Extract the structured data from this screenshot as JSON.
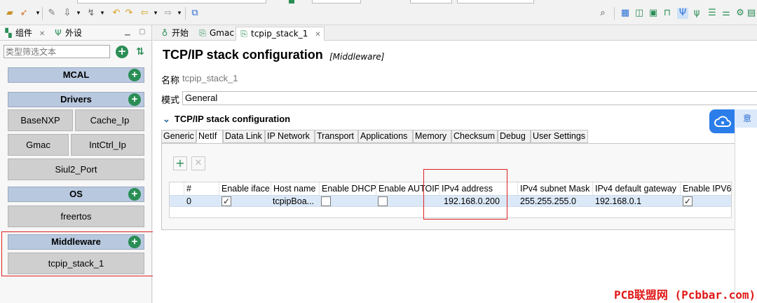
{
  "colors": {
    "accent_green": "#2a8e55",
    "highlight_red": "#e02020",
    "category_blue": "#b8c8df",
    "row_selected": "#dbe8f7",
    "watermark_red": "#e01818"
  },
  "toolbar": {
    "icons": [
      "folder-icon",
      "rocket-icon",
      "pencil-icon",
      "download-icon",
      "navigate-icon",
      "undo-icon",
      "back-icon",
      "forward-icon",
      "new-window-icon",
      "search-icon",
      "view-icons"
    ]
  },
  "left_panel": {
    "tabs": [
      {
        "label": "组件",
        "icon": "components-icon"
      },
      {
        "label": "外设",
        "icon": "peripherals-icon"
      }
    ],
    "filter_placeholder": "类型筛选文本",
    "categories": [
      {
        "label": "MCAL",
        "items": []
      },
      {
        "label": "Drivers",
        "items": [
          "BaseNXP",
          "Cache_Ip",
          "Gmac",
          "IntCtrl_Ip",
          "Siul2_Port"
        ]
      },
      {
        "label": "OS",
        "items": [
          "freertos"
        ]
      },
      {
        "label": "Middleware",
        "items": [
          "tcpip_stack_1"
        ]
      }
    ]
  },
  "editor": {
    "tabs": [
      {
        "label": "开始",
        "icon": "bulb-icon"
      },
      {
        "label": "Gmac",
        "icon": "config-icon"
      },
      {
        "label": "tcpip_stack_1",
        "icon": "config-icon",
        "active": true
      }
    ],
    "title": "TCP/IP stack configuration",
    "title_sub": "[Middleware]",
    "name_label": "名称",
    "name_value": "tcpip_stack_1",
    "mode_label": "模式",
    "mode_value": "General",
    "section_title": "TCP/IP stack configuration",
    "sub_tabs": [
      "Generic",
      "NetIf",
      "Data Link",
      "IP Network",
      "Transport",
      "Applications",
      "Memory",
      "Checksum",
      "Debug",
      "User Settings"
    ],
    "active_sub_tab": "NetIf",
    "table": {
      "columns": [
        "#",
        "Enable iface",
        "Host name",
        "Enable DHCP",
        "Enable AUTOIP",
        "IPv4 address",
        "IPv4 subnet Mask",
        "IPv4 default gateway",
        "Enable IPV6"
      ],
      "rows": [
        {
          "index": "0",
          "enable_iface": true,
          "host_name": "tcpipBoa...",
          "enable_dhcp": false,
          "enable_autoip": false,
          "ipv4_address": "192.168.0.200",
          "subnet_mask": "255.255.255.0",
          "gateway": "192.168.0.1",
          "enable_ipv6": true
        }
      ]
    }
  },
  "overlay": {
    "side_label": "意"
  },
  "watermark": "PCB联盟网 (Pcbbar.com)"
}
